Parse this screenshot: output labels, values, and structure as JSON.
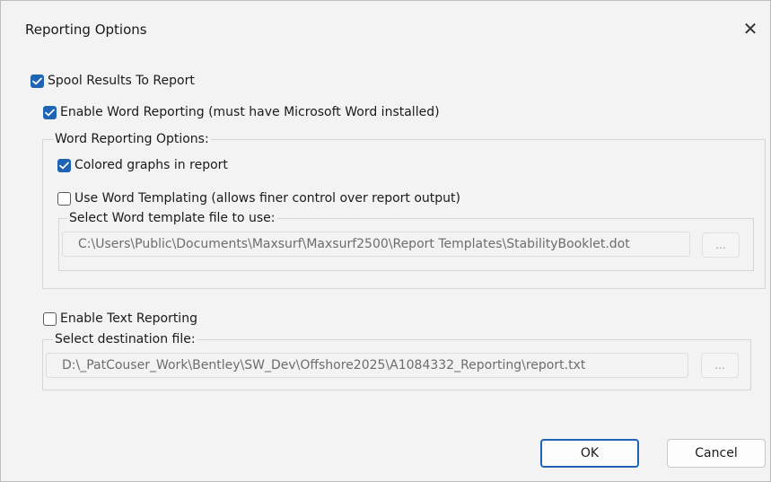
{
  "dialog": {
    "title": "Reporting Options",
    "close_glyph": "✕"
  },
  "spool": {
    "label": "Spool Results To Report",
    "checked": true
  },
  "word": {
    "enable_label": "Enable Word Reporting (must have Microsoft Word installed)",
    "enable_checked": true,
    "group_label": "Word Reporting Options:",
    "colored_label": "Colored graphs in report",
    "colored_checked": true,
    "templating_label": "Use Word Templating (allows finer control over report output)",
    "templating_checked": false,
    "template_label": "Select Word template file to use:",
    "template_path": "C:\\Users\\Public\\Documents\\Maxsurf\\Maxsurf2500\\Report Templates\\StabilityBooklet.dot",
    "browse_label": "..."
  },
  "text": {
    "enable_label": "Enable Text Reporting",
    "enable_checked": false,
    "dest_label": "Select destination file:",
    "dest_path": "D:\\_PatCouser_Work\\Bentley\\SW_Dev\\Offshore2025\\A1084332_Reporting\\report.txt",
    "browse_label": "..."
  },
  "buttons": {
    "ok": "OK",
    "cancel": "Cancel"
  },
  "colors": {
    "accent": "#1f64b4",
    "disabled_text": "#6d6d6d"
  },
  "icons": {
    "checkbox_checked": "check-icon",
    "close": "close-icon"
  }
}
